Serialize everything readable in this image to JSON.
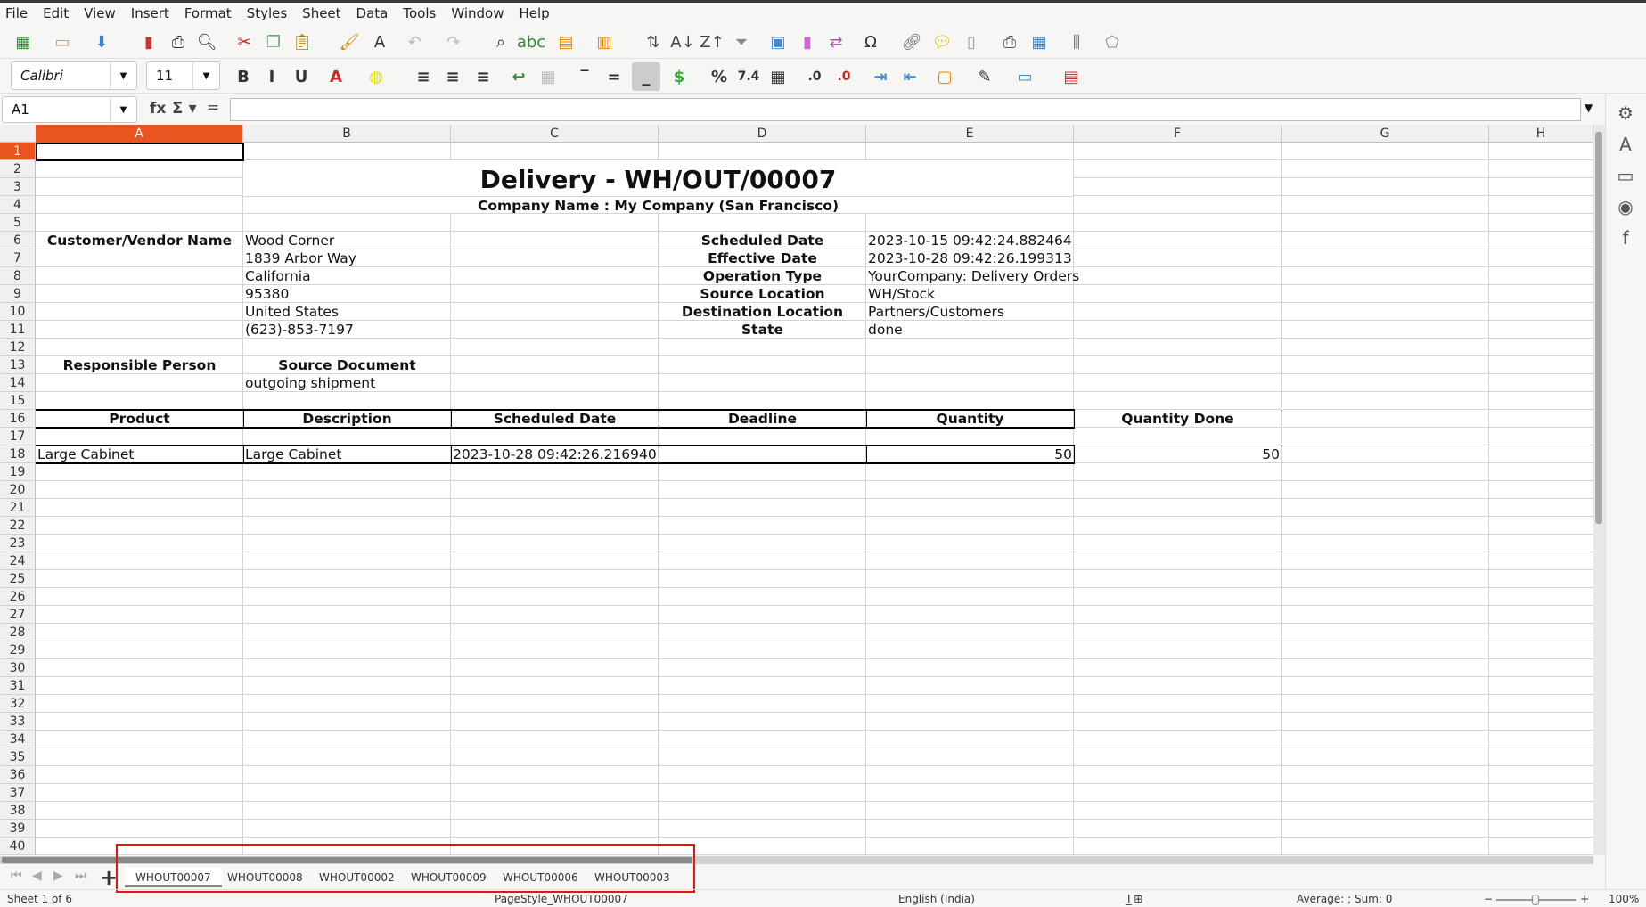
{
  "menu": [
    "File",
    "Edit",
    "View",
    "Insert",
    "Format",
    "Styles",
    "Sheet",
    "Data",
    "Tools",
    "Window",
    "Help"
  ],
  "toolbar1": [
    "new-spreadsheet",
    "open",
    "save",
    "export-pdf",
    "print",
    "print-preview",
    "cut",
    "copy",
    "paste",
    "clone-formatting",
    "clear-formatting",
    "undo",
    "redo",
    "find-replace",
    "spelling",
    "insert-rows",
    "insert-columns",
    "sort",
    "sort-ascending",
    "sort-descending",
    "autofilter",
    "insert-image",
    "insert-chart",
    "pivot-table",
    "special-character",
    "hyperlink",
    "comment",
    "headers-footers",
    "define-print-area",
    "freeze-rows-columns",
    "split-window",
    "show-draw-functions"
  ],
  "toolbar2": {
    "font_name": "Calibri",
    "font_size": "11",
    "icons": [
      "bold",
      "italic",
      "underline",
      "font-color",
      "highlight-color",
      "align-left",
      "align-center",
      "align-right",
      "wrap-text",
      "merge-center",
      "align-top",
      "align-middle",
      "align-bottom",
      "currency-format",
      "percent-format",
      "number-format",
      "date-format",
      "add-decimal",
      "delete-decimal",
      "increase-indent",
      "decrease-indent",
      "borders",
      "border-style",
      "border-color",
      "conditional-format"
    ],
    "number_label": "7.4",
    "percent_label": "%"
  },
  "formula_bar": {
    "cell_ref": "A1",
    "value": ""
  },
  "columns": [
    "A",
    "B",
    "C",
    "D",
    "E",
    "F",
    "G",
    "H"
  ],
  "selected_cell": "A1",
  "row_count": 40,
  "title": "Delivery - WH/OUT/00007",
  "company": "Company Name : My Company (San Francisco)",
  "cells": [
    {
      "r": 6,
      "c": "A",
      "t": "Customer/Vendor Name",
      "b": true,
      "al": "c"
    },
    {
      "r": 6,
      "c": "B",
      "t": "Wood Corner"
    },
    {
      "r": 7,
      "c": "B",
      "t": "1839 Arbor Way"
    },
    {
      "r": 8,
      "c": "B",
      "t": "California"
    },
    {
      "r": 9,
      "c": "B",
      "t": "95380"
    },
    {
      "r": 10,
      "c": "B",
      "t": "United States"
    },
    {
      "r": 11,
      "c": "B",
      "t": "(623)-853-7197"
    },
    {
      "r": 6,
      "c": "D",
      "t": "Scheduled Date",
      "b": true,
      "al": "c"
    },
    {
      "r": 7,
      "c": "D",
      "t": "Effective Date",
      "b": true,
      "al": "c"
    },
    {
      "r": 8,
      "c": "D",
      "t": "Operation Type",
      "b": true,
      "al": "c"
    },
    {
      "r": 9,
      "c": "D",
      "t": "Source Location",
      "b": true,
      "al": "c"
    },
    {
      "r": 10,
      "c": "D",
      "t": "Destination Location",
      "b": true,
      "al": "c"
    },
    {
      "r": 11,
      "c": "D",
      "t": "State",
      "b": true,
      "al": "c"
    },
    {
      "r": 6,
      "c": "E",
      "t": "2023-10-15 09:42:24.882464"
    },
    {
      "r": 7,
      "c": "E",
      "t": "2023-10-28 09:42:26.199313"
    },
    {
      "r": 8,
      "c": "E",
      "t": "YourCompany: Delivery Orders"
    },
    {
      "r": 9,
      "c": "E",
      "t": "WH/Stock"
    },
    {
      "r": 10,
      "c": "E",
      "t": "Partners/Customers"
    },
    {
      "r": 11,
      "c": "E",
      "t": "done"
    },
    {
      "r": 13,
      "c": "A",
      "t": "Responsible Person",
      "b": true,
      "al": "c"
    },
    {
      "r": 13,
      "c": "B",
      "t": "Source Document",
      "b": true,
      "al": "c"
    },
    {
      "r": 14,
      "c": "B",
      "t": "outgoing shipment"
    },
    {
      "r": 16,
      "c": "A",
      "t": "Product",
      "b": true,
      "al": "c"
    },
    {
      "r": 16,
      "c": "B",
      "t": "Description",
      "b": true,
      "al": "c"
    },
    {
      "r": 16,
      "c": "C",
      "t": "Scheduled Date",
      "b": true,
      "al": "c"
    },
    {
      "r": 16,
      "c": "D",
      "t": "Deadline",
      "b": true,
      "al": "c"
    },
    {
      "r": 16,
      "c": "E",
      "t": "Quantity",
      "b": true,
      "al": "c"
    },
    {
      "r": 16,
      "c": "F",
      "t": "Quantity Done",
      "b": true,
      "al": "c"
    },
    {
      "r": 18,
      "c": "A",
      "t": "Large Cabinet"
    },
    {
      "r": 18,
      "c": "B",
      "t": "Large Cabinet"
    },
    {
      "r": 18,
      "c": "C",
      "t": "2023-10-28 09:42:26.216940"
    },
    {
      "r": 18,
      "c": "E",
      "t": "50",
      "al": "r"
    },
    {
      "r": 18,
      "c": "F",
      "t": "50",
      "al": "r"
    }
  ],
  "sidebar": [
    "properties",
    "styles",
    "gallery",
    "navigator",
    "functions"
  ],
  "sheet_tabs": [
    "WHOUT00007",
    "WHOUT00008",
    "WHOUT00002",
    "WHOUT00009",
    "WHOUT00006",
    "WHOUT00003"
  ],
  "active_tab": 0,
  "status": {
    "sheet": "Sheet 1 of 6",
    "page_style": "PageStyle_WHOUT00007",
    "language": "English (India)",
    "summary": "Average: ; Sum: 0",
    "zoom": "100%"
  },
  "colors": {
    "accent": "#e95420",
    "annotation": "#ee1111"
  }
}
